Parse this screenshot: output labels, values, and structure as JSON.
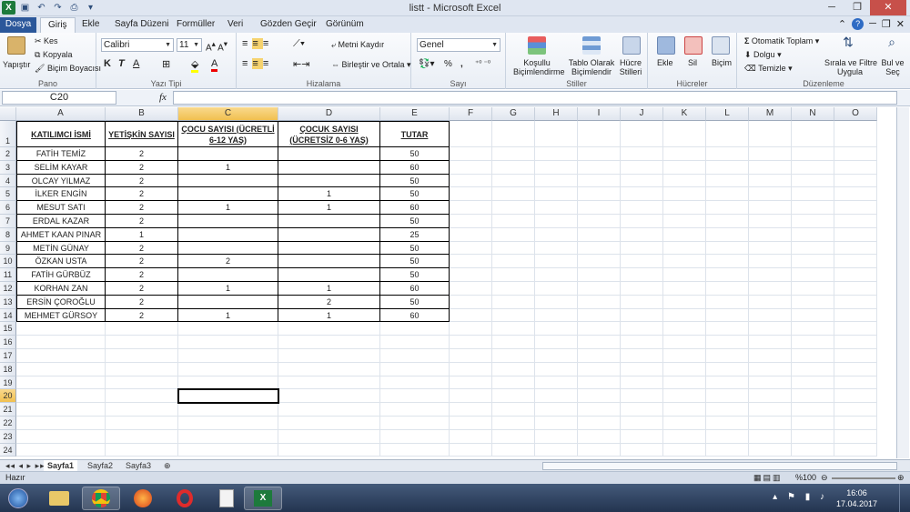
{
  "window": {
    "title": "listt  -  Microsoft Excel"
  },
  "tabs": [
    "Dosya",
    "Giriş",
    "Ekle",
    "Sayfa Düzeni",
    "Formüller",
    "Veri",
    "Gözden Geçir",
    "Görünüm"
  ],
  "ribbon": {
    "pano": {
      "label": "Pano",
      "paste": "Yapıştır",
      "cut": "Kes",
      "copy": "Kopyala",
      "format_painter": "Biçim Boyacısı"
    },
    "font": {
      "label": "Yazı Tipi",
      "name": "Calibri",
      "size": "11",
      "bold": "K",
      "italic": "T",
      "underline": "A"
    },
    "align": {
      "label": "Hizalama",
      "wrap": "Metni Kaydır",
      "merge": "Birleştir ve Ortala"
    },
    "number": {
      "label": "Sayı",
      "format": "Genel",
      "percent": "%",
      "comma": ","
    },
    "styles": {
      "label": "Stiller",
      "conditional_1": "Koşullu",
      "conditional_2": "Biçimlendirme",
      "table_1": "Tablo Olarak",
      "table_2": "Biçimlendir",
      "cell_1": "Hücre",
      "cell_2": "Stilleri"
    },
    "cells": {
      "label": "Hücreler",
      "insert": "Ekle",
      "delete": "Sil",
      "format": "Biçim"
    },
    "editing": {
      "label": "Düzenleme",
      "autosum": "Otomatik Toplam",
      "fill": "Dolgu",
      "clear": "Temizle",
      "sort_1": "Sırala ve Filtre",
      "sort_2": "Uygula",
      "find_1": "Bul ve",
      "find_2": "Seç"
    }
  },
  "formula_bar": {
    "name_box": "C20",
    "fx": "fx",
    "value": ""
  },
  "columns": [
    "A",
    "B",
    "C",
    "D",
    "E",
    "F",
    "G",
    "H",
    "I",
    "J",
    "K",
    "L",
    "M",
    "N",
    "O"
  ],
  "rows": [
    "1",
    "2",
    "3",
    "4",
    "5",
    "6",
    "7",
    "8",
    "9",
    "10",
    "11",
    "12",
    "13",
    "14",
    "15",
    "16",
    "17",
    "18",
    "19",
    "20",
    "21",
    "22",
    "23",
    "24"
  ],
  "table": {
    "headers": [
      "KATILIMCI İSMİ",
      "YETİŞKİN SAYISI",
      "ÇOCU SAYISI (ÜCRETLİ 6-12 YAŞ)",
      "ÇOCUK SAYISI (ÜCRETSİZ 0-6 YAŞ)",
      "TUTAR"
    ],
    "rows": [
      [
        "FATİH TEMİZ",
        "2",
        "",
        "",
        "50"
      ],
      [
        "SELİM KAYAR",
        "2",
        "1",
        "",
        "60"
      ],
      [
        "OLCAY YILMAZ",
        "2",
        "",
        "",
        "50"
      ],
      [
        "İLKER ENGİN",
        "2",
        "",
        "1",
        "50"
      ],
      [
        "MESUT SATI",
        "2",
        "1",
        "1",
        "60"
      ],
      [
        "ERDAL KAZAR",
        "2",
        "",
        "",
        "50"
      ],
      [
        "AHMET KAAN PINAR",
        "1",
        "",
        "",
        "25"
      ],
      [
        "METİN GÜNAY",
        "2",
        "",
        "",
        "50"
      ],
      [
        "ÖZKAN USTA",
        "2",
        "2",
        "",
        "50"
      ],
      [
        "FATİH GÜRBÜZ",
        "2",
        "",
        "",
        "50"
      ],
      [
        "KORHAN ZAN",
        "2",
        "1",
        "1",
        "60"
      ],
      [
        "ERSİN ÇOROĞLU",
        "2",
        "",
        "2",
        "50"
      ],
      [
        "MEHMET GÜRSOY",
        "2",
        "1",
        "1",
        "60"
      ]
    ]
  },
  "sheets": [
    "Sayfa1",
    "Sayfa2",
    "Sayfa3"
  ],
  "status": {
    "ready": "Hazır",
    "zoom": "%100"
  },
  "clock": {
    "time": "16:06",
    "date": "17.04.2017"
  },
  "colors": {
    "accent": "#2b579a",
    "excel_green": "#1d7a3c",
    "selected_header": "#f1c050"
  }
}
